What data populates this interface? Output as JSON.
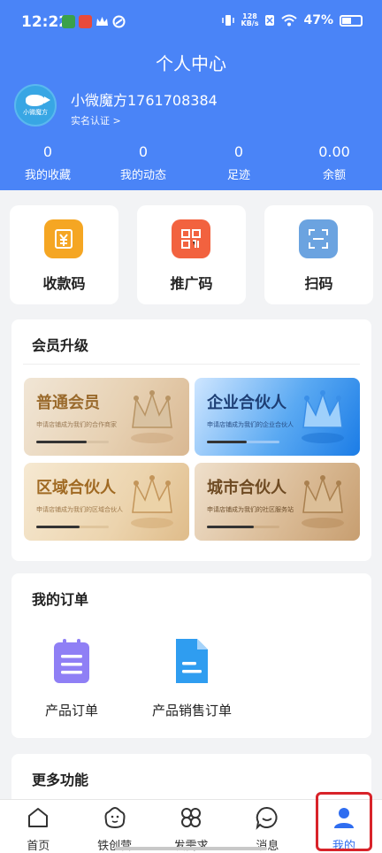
{
  "status_bar": {
    "time": "12:22",
    "net_speed_top": "128",
    "net_speed_bottom": "KB/s",
    "battery": "47%"
  },
  "header": {
    "title": "个人中心",
    "avatar_text": "小微魔方",
    "username": "小微魔方1761708384",
    "verify_link": "实名认证 >",
    "stats": [
      {
        "value": "0",
        "label": "我的收藏"
      },
      {
        "value": "0",
        "label": "我的动态"
      },
      {
        "value": "0",
        "label": "足迹"
      },
      {
        "value": "0.00",
        "label": "余额"
      }
    ]
  },
  "quick_actions": [
    {
      "label": "收款码",
      "icon": "payment-code-icon",
      "color": "#f5a623"
    },
    {
      "label": "推广码",
      "icon": "promo-qr-icon",
      "color": "#f2623f"
    },
    {
      "label": "扫码",
      "icon": "scan-icon",
      "color": "#6ba3e0"
    }
  ],
  "membership": {
    "title": "会员升级",
    "cards": [
      {
        "title": "普通会员",
        "subtitle": "申请店铺成为我们的合作商家"
      },
      {
        "title": "企业合伙人",
        "subtitle": "申请店铺成为我们的企业合伙人"
      },
      {
        "title": "区域合伙人",
        "subtitle": "申请店铺成为我们的区域合伙人"
      },
      {
        "title": "城市合伙人",
        "subtitle": "申请店铺成为我们的社区服务站"
      }
    ]
  },
  "orders": {
    "title": "我的订单",
    "items": [
      {
        "label": "产品订单",
        "icon": "clipboard-list-icon"
      },
      {
        "label": "产品销售订单",
        "icon": "document-icon"
      }
    ]
  },
  "more": {
    "title": "更多功能"
  },
  "bottom_nav": [
    {
      "label": "首页",
      "icon": "home-icon"
    },
    {
      "label": "铁创营",
      "icon": "camp-icon"
    },
    {
      "label": "发需求",
      "icon": "grid-clover-icon"
    },
    {
      "label": "消息",
      "icon": "chat-icon"
    },
    {
      "label": "我的",
      "icon": "user-icon",
      "active": true
    }
  ],
  "colors": {
    "header_bg": "#4a84f7",
    "active_nav": "#2f6df0",
    "highlight_border": "#d8232a"
  }
}
